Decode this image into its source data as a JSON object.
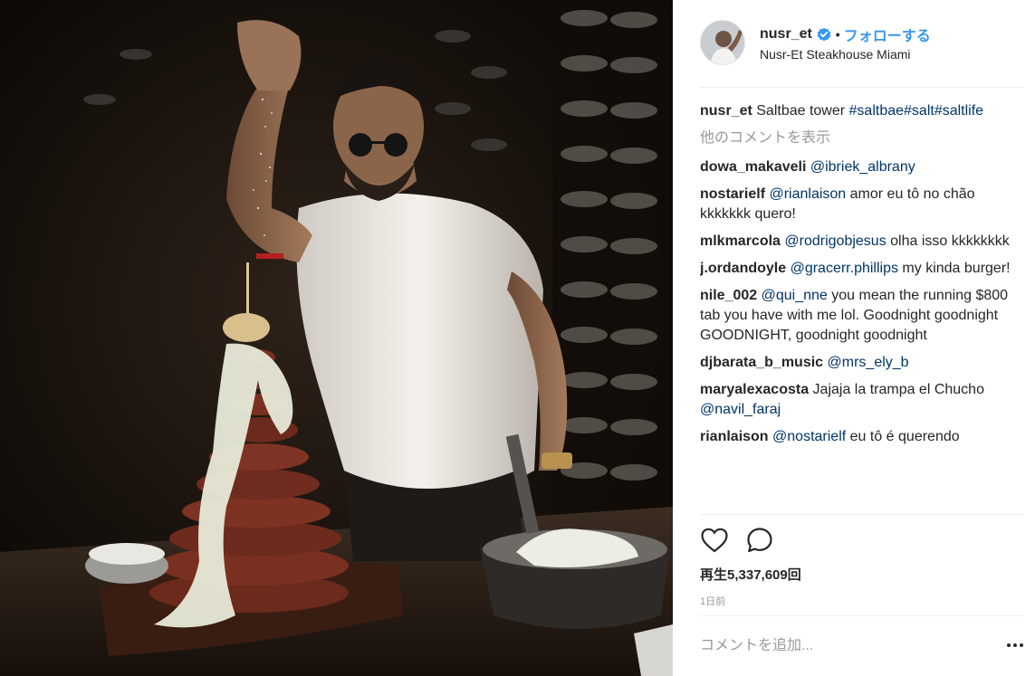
{
  "post": {
    "header": {
      "username": "nusr_et",
      "separator": "•",
      "follow_label": "フォローする",
      "location": "Nusr-Et Steakhouse Miami"
    },
    "caption": {
      "username": "nusr_et",
      "text": "Saltbae tower ",
      "hashtags": "#saltbae#salt#saltlife"
    },
    "load_more_label": "他のコメントを表示",
    "comments": [
      {
        "username": "dowa_makaveli",
        "mention": "@ibriek_albrany",
        "text": ""
      },
      {
        "username": "nostarielf",
        "mention": "@rianlaison",
        "text": " amor eu tô no chão kkkkkkk quero!"
      },
      {
        "username": "mlkmarcola",
        "mention": "@rodrigobjesus",
        "text": " olha isso kkkkkkkk"
      },
      {
        "username": "j.ordandoyle",
        "mention": "@gracerr.phillips",
        "text": " my kinda burger!"
      },
      {
        "username": "nile_002",
        "mention": "@qui_nne",
        "text": " you mean the running $800 tab you have with me lol. Goodnight goodnight GOODNIGHT, goodnight goodnight"
      },
      {
        "username": "djbarata_b_music",
        "mention": "@mrs_ely_b",
        "text": ""
      },
      {
        "username": "maryalexacosta",
        "text_before": " Jajaja la trampa el Chucho ",
        "mention": "@navil_faraj",
        "text": ""
      },
      {
        "username": "rianlaison",
        "mention": "@nostarielf",
        "text": " eu tô é querendo"
      }
    ],
    "actions": {
      "like_icon": "heart-outline-icon",
      "comment_icon": "speech-bubble-icon"
    },
    "views_label": "再生5,337,609回",
    "timestamp": "1日前",
    "add_comment_placeholder": "コメントを追加...",
    "more_options_icon": "ellipsis-icon",
    "colors": {
      "link": "#003569",
      "follow": "#3897f0",
      "muted": "#999999",
      "verified": "#3897f0"
    }
  }
}
